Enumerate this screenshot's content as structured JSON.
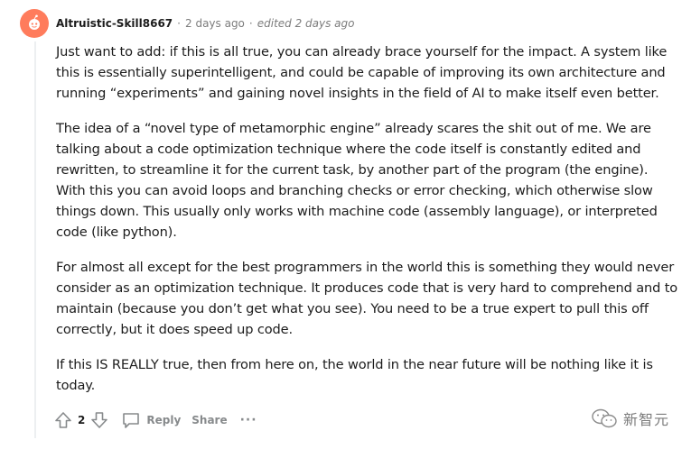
{
  "comment": {
    "username": "Altruistic-Skill8667",
    "separator": "·",
    "time": "2 days ago",
    "edited": "edited 2 days ago",
    "paragraphs": [
      "Just want to add: if this is all true, you can already brace yourself for the impact. A system like this is essentially superintelligent, and could be capable of improving its own architecture and running “experiments” and gaining novel insights in the field of AI to make itself even better.",
      "The idea of a “novel type of metamorphic engine” already scares the shit out of me. We are talking about a code optimization technique where the code itself is constantly edited and rewritten, to streamline it for the current task, by another part of the program (the engine). With this you can avoid loops and branching checks or error checking, which otherwise slow things down. This usually only works with machine code (assembly language), or interpreted code (like python).",
      "For almost all except for the best programmers in the world this is something they would never consider as an optimization technique. It produces code that is very hard to comprehend and to maintain (because you don’t get what you see). You need to be a true expert to pull this off correctly, but it does speed up code.",
      "If this IS REALLY true, then from here on, the world in the near future will be nothing like it is today."
    ]
  },
  "actions": {
    "score": "2",
    "reply_label": "Reply",
    "share_label": "Share",
    "more_label": "···"
  },
  "watermark": {
    "text": "新智元"
  },
  "colors": {
    "avatar": "#ff7c5c",
    "muted": "#7c7c7c",
    "action": "#878a8c",
    "thread_line": "#edeff1"
  }
}
